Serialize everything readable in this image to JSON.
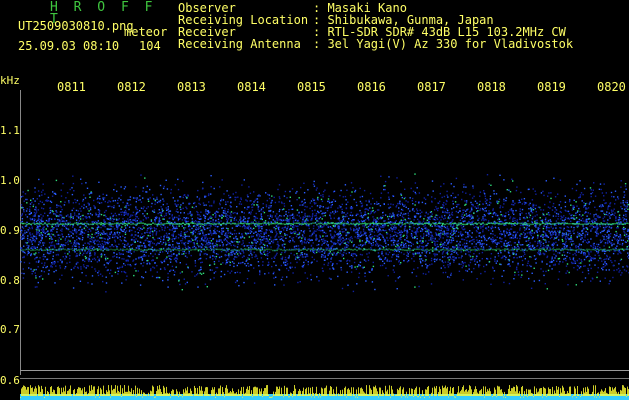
{
  "header": {
    "app_title": "H R O F F T",
    "filename": "UT2509030810.png",
    "detection_label": "meteor",
    "datetime": "25.09.03 08:10",
    "count": "104",
    "info": [
      {
        "label": "Observer",
        "value": ": Masaki Kano"
      },
      {
        "label": "Receiving Location",
        "value": ": Shibukawa, Gunma, Japan"
      },
      {
        "label": "Receiver",
        "value": ": RTL-SDR SDR# 43dB L15 103.2MHz CW"
      },
      {
        "label": "Receiving Antenna",
        "value": ": 3el Yagi(V) Az 330 for Vladivostok"
      }
    ]
  },
  "time_axis": {
    "ticks": [
      "0811",
      "0812",
      "0813",
      "0814",
      "0815",
      "0816",
      "0817",
      "0818",
      "0819",
      "0820"
    ]
  },
  "freq_axis": {
    "unit": "kHz",
    "ticks": [
      "1.1",
      "1.0",
      "0.9",
      "0.8",
      "0.7",
      "0.6"
    ]
  },
  "colors": {
    "text": "#ffff66",
    "title": "#3fc63f",
    "noise_low": "#1020a0",
    "noise_mid": "#2a5cff",
    "signal": "#2fdc7a",
    "bars": "#ffff33",
    "bars_base": "#33ccff"
  }
}
